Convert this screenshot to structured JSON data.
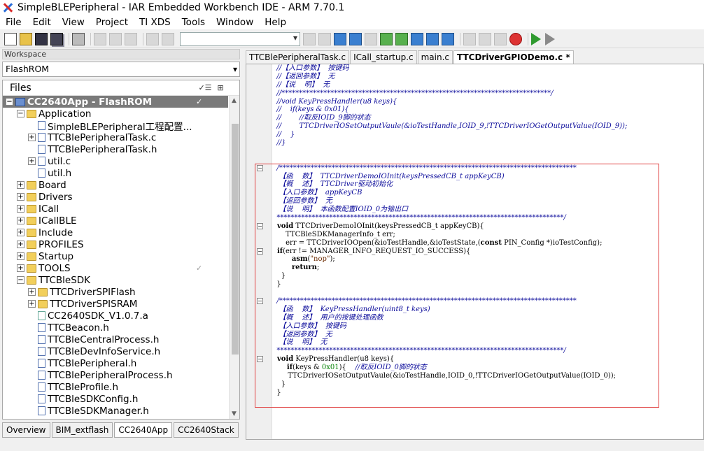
{
  "window": {
    "title": "SimpleBLEPeripheral - IAR Embedded Workbench IDE - ARM 7.70.1"
  },
  "menu": [
    "File",
    "Edit",
    "View",
    "Project",
    "TI XDS",
    "Tools",
    "Window",
    "Help"
  ],
  "workspace": {
    "header": "Workspace",
    "config": "FlashROM",
    "files_label": "Files",
    "tree": [
      {
        "label": "CC2640App - FlashROM",
        "indent": 0,
        "exp": "−",
        "icon": "project",
        "selected": true,
        "check": true
      },
      {
        "label": "Application",
        "indent": 1,
        "exp": "−",
        "icon": "folder"
      },
      {
        "label": "SimpleBLEPeripheral工程配置...",
        "indent": 2,
        "exp": "",
        "icon": "file"
      },
      {
        "label": "TTCBlePeripheralTask.c",
        "indent": 2,
        "exp": "+",
        "icon": "file"
      },
      {
        "label": "TTCBlePeripheralTask.h",
        "indent": 2,
        "exp": "",
        "icon": "file"
      },
      {
        "label": "util.c",
        "indent": 2,
        "exp": "+",
        "icon": "file"
      },
      {
        "label": "util.h",
        "indent": 2,
        "exp": "",
        "icon": "file"
      },
      {
        "label": "Board",
        "indent": 1,
        "exp": "+",
        "icon": "folder"
      },
      {
        "label": "Drivers",
        "indent": 1,
        "exp": "+",
        "icon": "folder"
      },
      {
        "label": "ICall",
        "indent": 1,
        "exp": "+",
        "icon": "folder"
      },
      {
        "label": "ICallBLE",
        "indent": 1,
        "exp": "+",
        "icon": "folder"
      },
      {
        "label": "Include",
        "indent": 1,
        "exp": "+",
        "icon": "folder"
      },
      {
        "label": "PROFILES",
        "indent": 1,
        "exp": "+",
        "icon": "folder"
      },
      {
        "label": "Startup",
        "indent": 1,
        "exp": "+",
        "icon": "folder"
      },
      {
        "label": "TOOLS",
        "indent": 1,
        "exp": "+",
        "icon": "folder",
        "check": true
      },
      {
        "label": "TTCBleSDK",
        "indent": 1,
        "exp": "−",
        "icon": "folder"
      },
      {
        "label": "TTCDriverSPIFlash",
        "indent": 2,
        "exp": "+",
        "icon": "folder"
      },
      {
        "label": "TTCDriverSPISRAM",
        "indent": 2,
        "exp": "+",
        "icon": "folder"
      },
      {
        "label": "CC2640SDK_V1.0.7.a",
        "indent": 2,
        "exp": "",
        "icon": "lib"
      },
      {
        "label": "TTCBeacon.h",
        "indent": 2,
        "exp": "",
        "icon": "file"
      },
      {
        "label": "TTCBleCentralProcess.h",
        "indent": 2,
        "exp": "",
        "icon": "file"
      },
      {
        "label": "TTCBleDevInfoService.h",
        "indent": 2,
        "exp": "",
        "icon": "file"
      },
      {
        "label": "TTCBlePeripheral.h",
        "indent": 2,
        "exp": "",
        "icon": "file"
      },
      {
        "label": "TTCBlePeripheralProcess.h",
        "indent": 2,
        "exp": "",
        "icon": "file"
      },
      {
        "label": "TTCBleProfile.h",
        "indent": 2,
        "exp": "",
        "icon": "file"
      },
      {
        "label": "TTCBleSDKConfig.h",
        "indent": 2,
        "exp": "",
        "icon": "file"
      },
      {
        "label": "TTCBleSDKManager.h",
        "indent": 2,
        "exp": "",
        "icon": "file"
      }
    ],
    "tabs": [
      "Overview",
      "BIM_extflash",
      "CC2640App",
      "CC2640Stack"
    ],
    "active_tab": "CC2640App"
  },
  "editor": {
    "tabs": [
      "TTCBlePeripheralTask.c",
      "ICall_startup.c",
      "main.c",
      "TTCDriverGPIODemo.c *"
    ],
    "active_tab": "TTCDriverGPIODemo.c *",
    "lines": [
      {
        "f": "",
        "t": [
          [
            "c",
            "  //【入口参数】  按键码"
          ]
        ]
      },
      {
        "f": "",
        "t": [
          [
            "c",
            "  //【返回参数】  无"
          ]
        ]
      },
      {
        "f": "",
        "t": [
          [
            "c",
            "  //【说    明】  无"
          ]
        ]
      },
      {
        "f": "",
        "t": [
          [
            "c",
            "  //*****************************************************************************/"
          ]
        ]
      },
      {
        "f": "",
        "t": [
          [
            "c",
            "  //void KeyPressHandler(u8 keys){"
          ]
        ]
      },
      {
        "f": "",
        "t": [
          [
            "c",
            "  //    if(keys & 0x01){"
          ]
        ]
      },
      {
        "f": "",
        "t": [
          [
            "c",
            "  //        //取反IOID_9脚的状态"
          ]
        ]
      },
      {
        "f": "",
        "t": [
          [
            "c",
            "  //        TTCDriverIOSetOutputVaule(&ioTestHandle,IOID_9,!TTCDriverIOGetOutputValue(IOID_9));"
          ]
        ]
      },
      {
        "f": "",
        "t": [
          [
            "c",
            "  //    }"
          ]
        ]
      },
      {
        "f": "",
        "t": [
          [
            "c",
            "  //}"
          ]
        ]
      },
      {
        "f": "",
        "t": [
          [
            "p",
            ""
          ]
        ]
      },
      {
        "f": "",
        "t": [
          [
            "p",
            ""
          ]
        ]
      },
      {
        "f": "−",
        "t": [
          [
            "c",
            "  /*************************************************************************************"
          ]
        ]
      },
      {
        "f": "",
        "t": [
          [
            "c",
            "   【函    数】  TTCDriverDemoIOInit(keysPressedCB_t appKeyCB)"
          ]
        ]
      },
      {
        "f": "",
        "t": [
          [
            "c",
            "   【概    述】  TTCDriver驱动初始化"
          ]
        ]
      },
      {
        "f": "",
        "t": [
          [
            "c",
            "   【入口参数】  appKeyCB"
          ]
        ]
      },
      {
        "f": "",
        "t": [
          [
            "c",
            "   【返回参数】  无"
          ]
        ]
      },
      {
        "f": "",
        "t": [
          [
            "c",
            "   【说    明】  本函数配置IOID_0为输出口"
          ]
        ]
      },
      {
        "f": "",
        "t": [
          [
            "c",
            "  **********************************************************************************/"
          ]
        ]
      },
      {
        "f": "−",
        "t": [
          [
            "k",
            "  void"
          ],
          [
            "p",
            " TTCDriverDemoIOInit(keysPressedCB_t appKeyCB){"
          ]
        ]
      },
      {
        "f": "",
        "t": [
          [
            "p",
            "      TTCBleSDKManagerInfo_t err;"
          ]
        ]
      },
      {
        "f": "",
        "t": [
          [
            "p",
            "      err = TTCDriverIOOpen(&ioTestHandle,&ioTestState,("
          ],
          [
            "k",
            "const"
          ],
          [
            "p",
            " PIN_Config *)ioTestConfig);"
          ]
        ]
      },
      {
        "f": "−",
        "t": [
          [
            "k",
            "  if"
          ],
          [
            "p",
            "(err != MANAGER_INFO_REQUEST_IO_SUCCESS){"
          ]
        ]
      },
      {
        "f": "",
        "t": [
          [
            "k",
            "        asm"
          ],
          [
            "p",
            "("
          ],
          [
            "s",
            "\"nop\""
          ],
          [
            "p",
            ");"
          ]
        ]
      },
      {
        "f": "",
        "t": [
          [
            "k",
            "        return"
          ],
          [
            "p",
            ";"
          ]
        ]
      },
      {
        "f": "",
        "t": [
          [
            "p",
            "    }"
          ]
        ]
      },
      {
        "f": "",
        "t": [
          [
            "p",
            "  }"
          ]
        ]
      },
      {
        "f": "",
        "t": [
          [
            "p",
            ""
          ]
        ]
      },
      {
        "f": "−",
        "t": [
          [
            "c",
            "  /*************************************************************************************"
          ]
        ]
      },
      {
        "f": "",
        "t": [
          [
            "c",
            "   【函    数】  KeyPressHandler(uint8_t keys)"
          ]
        ]
      },
      {
        "f": "",
        "t": [
          [
            "c",
            "   【概    述】  用户的按键处理函数"
          ]
        ]
      },
      {
        "f": "",
        "t": [
          [
            "c",
            "   【入口参数】  按键码"
          ]
        ]
      },
      {
        "f": "",
        "t": [
          [
            "c",
            "   【返回参数】  无"
          ]
        ]
      },
      {
        "f": "",
        "t": [
          [
            "c",
            "   【说    明】  无"
          ]
        ]
      },
      {
        "f": "",
        "t": [
          [
            "c",
            "  **********************************************************************************/"
          ]
        ]
      },
      {
        "f": "−",
        "t": [
          [
            "k",
            "  void"
          ],
          [
            "p",
            " KeyPressHandler(u8 keys){"
          ]
        ]
      },
      {
        "f": "",
        "t": [
          [
            "k",
            "      if"
          ],
          [
            "p",
            "(keys & "
          ],
          [
            "n",
            "0x01"
          ],
          [
            "p",
            "){    "
          ],
          [
            "c",
            "//取反IOID_0脚的状态"
          ]
        ]
      },
      {
        "f": "",
        "t": [
          [
            "p",
            "       TTCDriverIOSetOutputVaule(&ioTestHandle,IOID_0,!TTCDriverIOGetOutputValue(IOID_0));"
          ]
        ]
      },
      {
        "f": "",
        "t": [
          [
            "p",
            "    }"
          ]
        ]
      },
      {
        "f": "",
        "t": [
          [
            "p",
            "  }"
          ]
        ]
      }
    ]
  }
}
